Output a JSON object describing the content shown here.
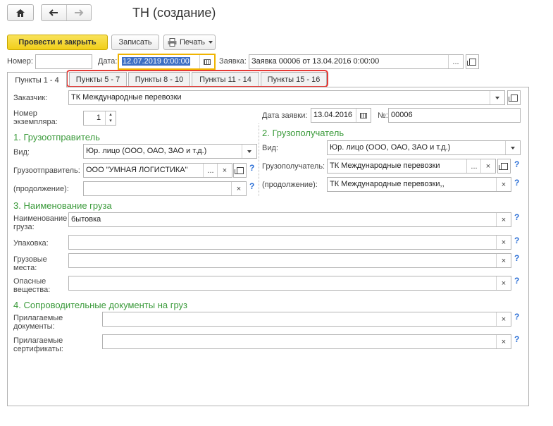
{
  "window": {
    "title": "ТН (создание)"
  },
  "nav": {
    "home_icon": "home-icon",
    "back_icon": "arrow-left-icon",
    "forward_icon": "arrow-right-icon"
  },
  "toolbar": {
    "post_close": "Провести и закрыть",
    "save": "Записать",
    "print": "Печать"
  },
  "header": {
    "number_label": "Номер:",
    "number_value": "",
    "date_label": "Дата:",
    "date_value": "12.07.2019  0:00:00",
    "request_label": "Заявка:",
    "request_value": "Заявка 00006 от 13.04.2016 0:00:00"
  },
  "tabs": [
    "Пункты 1 - 4",
    "Пункты 5 - 7",
    "Пункты 8 - 10",
    "Пункты 11 - 14",
    "Пункты 15 - 16"
  ],
  "form": {
    "customer_label": "Заказчик:",
    "customer_value": "ТК Международные перевозки",
    "copies_label": "Номер экземпляра:",
    "copies_value": "1",
    "req_date_label": "Дата заявки:",
    "req_date_value": "13.04.2016",
    "req_no_label": "№:",
    "req_no_value": "00006",
    "s1": "1. Грузоотправитель",
    "s2": "2. Грузополучатель",
    "kind_label": "Вид:",
    "kind1_value": "Юр. лицо (ООО, ОАО, ЗАО и т.д.)",
    "kind2_value": "Юр. лицо (ООО, ОАО, ЗАО и т.д.)",
    "shipper_label": "Грузоотправитель:",
    "shipper_value": "ООО \"УМНАЯ ЛОГИСТИКА\"",
    "cont_label": "(продолжение):",
    "cont1_value": "",
    "consignee_label": "Грузополучатель:",
    "consignee_value": "ТК Международные перевозки",
    "cont2_value": "ТК Международные перевозки,,",
    "s3": "3. Наименование груза",
    "cargo_label": "Наименование груза:",
    "cargo_value": "бытовка",
    "pack_label": "Упаковка:",
    "pack_value": "",
    "places_label": "Грузовые места:",
    "places_value": "",
    "danger_label": "Опасные вещества:",
    "danger_value": "",
    "s4": "4. Сопроводительные документы на груз",
    "docs_label": "Прилагаемые документы:",
    "docs_value": "",
    "certs_label": "Прилагаемые сертификаты:",
    "certs_value": "",
    "help": "?",
    "clear": "×",
    "more": "...",
    "dropdown_icon": "chevron-down-icon",
    "copy_icon": "open-icon",
    "calendar_icon": "calendar-icon"
  },
  "colors": {
    "accent_yellow": "#f5d327",
    "highlight_red": "#e53935",
    "section_green": "#3a9a3a",
    "help_blue": "#2b6fd6",
    "date_focus": "#f0b400"
  }
}
